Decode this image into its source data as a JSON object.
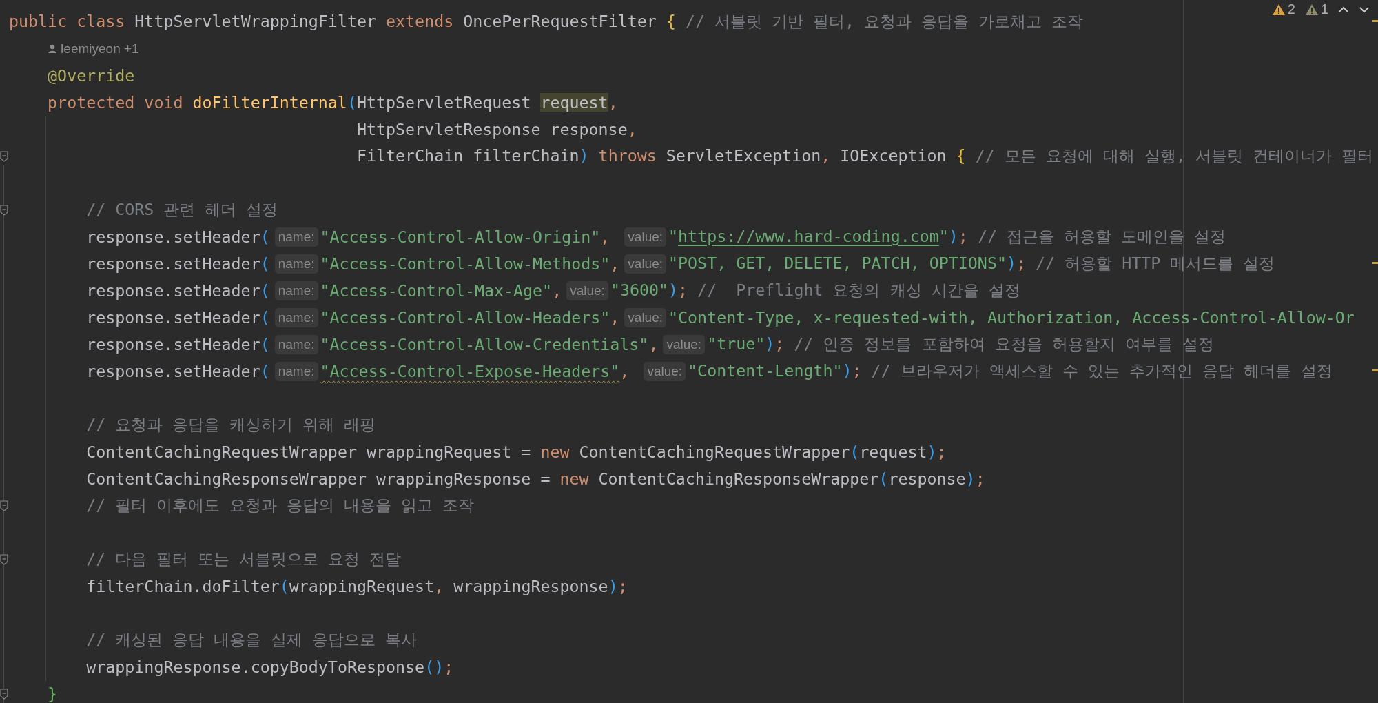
{
  "problems": [
    {
      "kind": "warning",
      "count": "2"
    },
    {
      "kind": "weak-warning",
      "count": "1"
    }
  ],
  "lines": [
    {
      "kind": "code",
      "warning_mark": true,
      "segments": [
        {
          "kind": "code",
          "tokens": [
            {
              "kind": "keyword",
              "text": "public class "
            },
            {
              "kind": "plain",
              "text": "HttpServletWrappingFilter "
            },
            {
              "kind": "keyword",
              "text": "extends "
            },
            {
              "kind": "plain",
              "text": "OncePerRequestFilter "
            },
            {
              "kind": "brace",
              "text": "{"
            },
            {
              "kind": "comment",
              "text": " // 서블릿 기반 필터, 요청과 응답을 가로채고 조작"
            }
          ]
        }
      ],
      "children": [
        {
          "kind": "code",
          "segments": [
            {
              "kind": "author",
              "text": "leemiyeon +1"
            }
          ]
        },
        {
          "kind": "code",
          "segments": [
            {
              "kind": "code",
              "tokens": [
                {
                  "kind": "annotation",
                  "text": "@Override"
                }
              ]
            }
          ]
        },
        {
          "kind": "code",
          "segments": [
            {
              "kind": "code",
              "tokens": [
                {
                  "kind": "keyword",
                  "text": "protected void "
                },
                {
                  "kind": "method",
                  "text": "doFilterInternal"
                },
                {
                  "kind": "paren",
                  "text": "("
                },
                {
                  "kind": "plain",
                  "text": "HttpServletRequest "
                },
                {
                  "kind": "usage",
                  "text": "request"
                },
                {
                  "kind": "punct",
                  "text": ","
                }
              ]
            }
          ],
          "continuation": [
            {
              "kind": "code",
              "segments": [
                {
                  "kind": "code",
                  "tokens": [
                    {
                      "kind": "plain",
                      "text": "HttpServletResponse response"
                    },
                    {
                      "kind": "punct",
                      "text": ","
                    }
                  ]
                }
              ]
            },
            {
              "kind": "code",
              "fold_marker": true,
              "segments": [
                {
                  "kind": "code",
                  "tokens": [
                    {
                      "kind": "plain",
                      "text": "FilterChain filterChain"
                    },
                    {
                      "kind": "paren",
                      "text": ")"
                    },
                    {
                      "kind": "keyword",
                      "text": " throws "
                    },
                    {
                      "kind": "plain",
                      "text": "ServletException"
                    },
                    {
                      "kind": "punct",
                      "text": ", "
                    },
                    {
                      "kind": "plain",
                      "text": "IOException "
                    },
                    {
                      "kind": "brace",
                      "text": "{"
                    },
                    {
                      "kind": "comment",
                      "text": " // 모든 요청에 대해 실행, 서블릿 컨테이너가 필터"
                    }
                  ]
                }
              ]
            }
          ],
          "children": [
            {
              "kind": "blank"
            },
            {
              "kind": "code",
              "fold_marker": true,
              "segments": [
                {
                  "kind": "code",
                  "tokens": [
                    {
                      "kind": "comment",
                      "text": "// CORS 관련 헤더 설정"
                    }
                  ]
                }
              ]
            },
            {
              "kind": "code",
              "segments": [
                {
                  "kind": "code",
                  "tokens": [
                    {
                      "kind": "plain",
                      "text": "response.setHeader"
                    },
                    {
                      "kind": "paren",
                      "text": "("
                    }
                  ]
                },
                {
                  "kind": "hint",
                  "text": "name:"
                },
                {
                  "kind": "code",
                  "tokens": [
                    {
                      "kind": "string",
                      "text": "\"Access-Control-Allow-Origin\""
                    },
                    {
                      "kind": "punct",
                      "text": ", "
                    }
                  ]
                },
                {
                  "kind": "hint",
                  "text": "value:"
                },
                {
                  "kind": "code",
                  "tokens": [
                    {
                      "kind": "string",
                      "text": "\""
                    },
                    {
                      "kind": "url",
                      "text": "https://www.hard-coding.com"
                    },
                    {
                      "kind": "string",
                      "text": "\""
                    },
                    {
                      "kind": "paren",
                      "text": ")"
                    },
                    {
                      "kind": "punct",
                      "text": ";"
                    },
                    {
                      "kind": "comment",
                      "text": " // 접근을 허용할 도메인을 설정"
                    }
                  ]
                }
              ]
            },
            {
              "kind": "code",
              "warning_mark": true,
              "segments": [
                {
                  "kind": "code",
                  "tokens": [
                    {
                      "kind": "plain",
                      "text": "response.setHeader"
                    },
                    {
                      "kind": "paren",
                      "text": "("
                    }
                  ]
                },
                {
                  "kind": "hint",
                  "text": "name:"
                },
                {
                  "kind": "code",
                  "tokens": [
                    {
                      "kind": "string",
                      "text": "\"Access-Control-Allow-Methods\""
                    },
                    {
                      "kind": "punct",
                      "text": ","
                    }
                  ]
                },
                {
                  "kind": "hint",
                  "text": "value:"
                },
                {
                  "kind": "code",
                  "tokens": [
                    {
                      "kind": "string",
                      "text": "\"POST, GET, DELETE, PATCH, OPTIONS\""
                    },
                    {
                      "kind": "paren",
                      "text": ")"
                    },
                    {
                      "kind": "punct",
                      "text": ";"
                    },
                    {
                      "kind": "comment",
                      "text": " // 허용할 HTTP 메서드를 설정"
                    }
                  ]
                }
              ]
            },
            {
              "kind": "code",
              "segments": [
                {
                  "kind": "code",
                  "tokens": [
                    {
                      "kind": "plain",
                      "text": "response.setHeader"
                    },
                    {
                      "kind": "paren",
                      "text": "("
                    }
                  ]
                },
                {
                  "kind": "hint",
                  "text": "name:"
                },
                {
                  "kind": "code",
                  "tokens": [
                    {
                      "kind": "string",
                      "text": "\"Access-Control-Max-Age\""
                    },
                    {
                      "kind": "punct",
                      "text": ","
                    }
                  ]
                },
                {
                  "kind": "hint",
                  "text": "value:"
                },
                {
                  "kind": "code",
                  "tokens": [
                    {
                      "kind": "string",
                      "text": "\"3600\""
                    },
                    {
                      "kind": "paren",
                      "text": ")"
                    },
                    {
                      "kind": "punct",
                      "text": ";"
                    },
                    {
                      "kind": "comment",
                      "text": " //  Preflight 요청의 캐싱 시간을 설정"
                    }
                  ]
                }
              ]
            },
            {
              "kind": "code",
              "segments": [
                {
                  "kind": "code",
                  "tokens": [
                    {
                      "kind": "plain",
                      "text": "response.setHeader"
                    },
                    {
                      "kind": "paren",
                      "text": "("
                    }
                  ]
                },
                {
                  "kind": "hint",
                  "text": "name:"
                },
                {
                  "kind": "code",
                  "tokens": [
                    {
                      "kind": "string",
                      "text": "\"Access-Control-Allow-Headers\""
                    },
                    {
                      "kind": "punct",
                      "text": ","
                    }
                  ]
                },
                {
                  "kind": "hint",
                  "text": "value:"
                },
                {
                  "kind": "code",
                  "tokens": [
                    {
                      "kind": "string",
                      "text": "\"Content-Type, x-requested-with, Authorization, Access-Control-Allow-Or"
                    }
                  ]
                }
              ]
            },
            {
              "kind": "code",
              "segments": [
                {
                  "kind": "code",
                  "tokens": [
                    {
                      "kind": "plain",
                      "text": "response.setHeader"
                    },
                    {
                      "kind": "paren",
                      "text": "("
                    }
                  ]
                },
                {
                  "kind": "hint",
                  "text": "name:"
                },
                {
                  "kind": "code",
                  "tokens": [
                    {
                      "kind": "string",
                      "text": "\"Access-Control-Allow-Credentials\""
                    },
                    {
                      "kind": "punct",
                      "text": ","
                    }
                  ]
                },
                {
                  "kind": "hint",
                  "text": "value:"
                },
                {
                  "kind": "code",
                  "tokens": [
                    {
                      "kind": "string",
                      "text": "\"true\""
                    },
                    {
                      "kind": "paren",
                      "text": ")"
                    },
                    {
                      "kind": "punct",
                      "text": ";"
                    },
                    {
                      "kind": "comment",
                      "text": " // 인증 정보를 포함하여 요청을 허용할지 여부를 설정"
                    }
                  ]
                }
              ]
            },
            {
              "kind": "code",
              "warning_mark": true,
              "segments": [
                {
                  "kind": "code",
                  "tokens": [
                    {
                      "kind": "plain",
                      "text": "response.setHeader"
                    },
                    {
                      "kind": "paren",
                      "text": "("
                    }
                  ]
                },
                {
                  "kind": "hint",
                  "text": "name:"
                },
                {
                  "kind": "code",
                  "tokens": [
                    {
                      "kind": "string-warning",
                      "text": "\"Access-Control-Expose-Headers\""
                    },
                    {
                      "kind": "punct",
                      "text": ", "
                    }
                  ]
                },
                {
                  "kind": "hint",
                  "text": "value:"
                },
                {
                  "kind": "code",
                  "tokens": [
                    {
                      "kind": "string",
                      "text": "\"Content-Length\""
                    },
                    {
                      "kind": "paren",
                      "text": ")"
                    },
                    {
                      "kind": "punct",
                      "text": ";"
                    },
                    {
                      "kind": "comment",
                      "text": " // 브라우저가 액세스할 수 있는 추가적인 응답 헤더를 설정"
                    }
                  ]
                }
              ]
            },
            {
              "kind": "blank"
            },
            {
              "kind": "code",
              "segments": [
                {
                  "kind": "code",
                  "tokens": [
                    {
                      "kind": "comment",
                      "text": "// 요청과 응답을 캐싱하기 위해 래핑"
                    }
                  ]
                }
              ]
            },
            {
              "kind": "code",
              "segments": [
                {
                  "kind": "code",
                  "tokens": [
                    {
                      "kind": "plain",
                      "text": "ContentCachingRequestWrapper wrappingRequest = "
                    },
                    {
                      "kind": "keyword",
                      "text": "new "
                    },
                    {
                      "kind": "plain",
                      "text": "ContentCachingRequestWrapper"
                    },
                    {
                      "kind": "paren",
                      "text": "("
                    },
                    {
                      "kind": "plain",
                      "text": "request"
                    },
                    {
                      "kind": "paren",
                      "text": ")"
                    },
                    {
                      "kind": "punct",
                      "text": ";"
                    }
                  ]
                }
              ]
            },
            {
              "kind": "code",
              "segments": [
                {
                  "kind": "code",
                  "tokens": [
                    {
                      "kind": "plain",
                      "text": "ContentCachingResponseWrapper wrappingResponse = "
                    },
                    {
                      "kind": "keyword",
                      "text": "new "
                    },
                    {
                      "kind": "plain",
                      "text": "ContentCachingResponseWrapper"
                    },
                    {
                      "kind": "paren",
                      "text": "("
                    },
                    {
                      "kind": "plain",
                      "text": "response"
                    },
                    {
                      "kind": "paren",
                      "text": ")"
                    },
                    {
                      "kind": "punct",
                      "text": ";"
                    }
                  ]
                }
              ]
            },
            {
              "kind": "code",
              "fold_marker": true,
              "segments": [
                {
                  "kind": "code",
                  "tokens": [
                    {
                      "kind": "comment",
                      "text": "// 필터 이후에도 요청과 응답의 내용을 읽고 조작"
                    }
                  ]
                }
              ]
            },
            {
              "kind": "blank"
            },
            {
              "kind": "code",
              "fold_marker": true,
              "segments": [
                {
                  "kind": "code",
                  "tokens": [
                    {
                      "kind": "comment",
                      "text": "// 다음 필터 또는 서블릿으로 요청 전달"
                    }
                  ]
                }
              ]
            },
            {
              "kind": "code",
              "segments": [
                {
                  "kind": "code",
                  "tokens": [
                    {
                      "kind": "plain",
                      "text": "filterChain.doFilter"
                    },
                    {
                      "kind": "paren",
                      "text": "("
                    },
                    {
                      "kind": "plain",
                      "text": "wrappingRequest"
                    },
                    {
                      "kind": "punct",
                      "text": ", "
                    },
                    {
                      "kind": "plain",
                      "text": "wrappingResponse"
                    },
                    {
                      "kind": "paren",
                      "text": ")"
                    },
                    {
                      "kind": "punct",
                      "text": ";"
                    }
                  ]
                }
              ]
            },
            {
              "kind": "blank"
            },
            {
              "kind": "code",
              "segments": [
                {
                  "kind": "code",
                  "tokens": [
                    {
                      "kind": "comment",
                      "text": "// 캐싱된 응답 내용을 실제 응답으로 복사"
                    }
                  ]
                }
              ]
            },
            {
              "kind": "code",
              "segments": [
                {
                  "kind": "code",
                  "tokens": [
                    {
                      "kind": "plain",
                      "text": "wrappingResponse.copyBodyToResponse"
                    },
                    {
                      "kind": "paren",
                      "text": "()"
                    },
                    {
                      "kind": "punct",
                      "text": ";"
                    }
                  ]
                }
              ]
            }
          ]
        },
        {
          "kind": "code",
          "fold_marker": true,
          "segments": [
            {
              "kind": "code",
              "tokens": [
                {
                  "kind": "brace-close",
                  "text": "}"
                }
              ]
            }
          ]
        }
      ]
    }
  ]
}
